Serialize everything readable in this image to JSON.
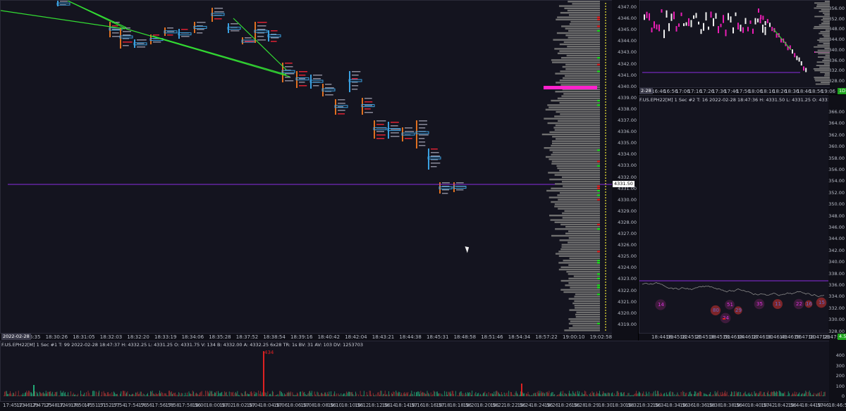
{
  "colors": {
    "background": "#14141f",
    "poc": "#ff22cc",
    "last_price_line": "#8a2be2",
    "volume_bars": "#6f6f6f",
    "trend_lines": "#33dd33"
  },
  "main_chart": {
    "price_axis": [
      "4347.00",
      "4346.00",
      "4345.00",
      "4344.00",
      "4343.00",
      "4342.00",
      "4341.00",
      "4340.00",
      "4339.00",
      "4338.00",
      "4337.00",
      "4336.00",
      "4335.00",
      "4334.00",
      "4333.00",
      "4332.00",
      "4331.00",
      "4330.00",
      "4329.00",
      "4328.00",
      "4327.00",
      "4326.00",
      "4325.00",
      "4324.00",
      "4323.00",
      "4322.00",
      "4321.00",
      "4320.00",
      "4319.00"
    ],
    "last_price_tag": "4331.50",
    "time_axis": [
      "18:26:35",
      "18:30:26",
      "18:31:05",
      "18:32:03",
      "18:32:20",
      "18:33:19",
      "18:34:06",
      "18:35:28",
      "18:37:52",
      "18:38:54",
      "18:39:16",
      "18:40:42",
      "18:42:04",
      "18:43:21",
      "18:44:38",
      "18:45:31",
      "18:48:58",
      "18:51:46",
      "18:54:34",
      "18:57:22",
      "19:00:10",
      "19:02:58"
    ],
    "date_tag": "2022-02-28"
  },
  "top_right_chart": {
    "price_axis": [
      "4356.00",
      "4352.00",
      "4348.00",
      "4344.00",
      "4340.00",
      "4336.00",
      "4332.00",
      "4328.00"
    ],
    "time_axis": [
      "16:46",
      "16:56",
      "17:06",
      "17:16",
      "17:26",
      "17:36",
      "17:46",
      "17:56",
      "18:06",
      "18:16",
      "18:26",
      "18:36",
      "18:46",
      "18:56",
      "19:06"
    ],
    "date_tag": "2-28",
    "corner_tag": "1D"
  },
  "mid_right_chart": {
    "info": "F.US.EPH22[M]  1 Sec  #2  T: 16  2022-02-28 18:47:36 H: 4331.50 L: 4331.25 O: 4331.25 V: 22 B: 433",
    "price_axis": [
      "4366.00",
      "4364.00",
      "4362.00",
      "4360.00",
      "4358.00",
      "4356.00",
      "4354.00",
      "4352.00",
      "4350.00",
      "4348.00",
      "4346.00",
      "4344.00",
      "4342.00",
      "4340.00",
      "4338.00",
      "4336.00",
      "4334.00",
      "4332.00",
      "4330.00",
      "4328.00"
    ],
    "time_axis": [
      "18:44:39",
      "18:45:12",
      "18:45:25",
      "18:45:38",
      "18:45:51",
      "18:46:04",
      "18:46:17",
      "18:46:30",
      "18:46:43",
      "18:46:56",
      "18:47:10",
      "18:47:23",
      "18:47:36"
    ],
    "bubble_labels": [
      "14",
      "80",
      "51",
      "29",
      "35",
      "11",
      "22",
      "16",
      "24",
      "15"
    ],
    "corner_tag": "4.5"
  },
  "bottom_chart": {
    "info": "F.US.EPH22[M]  1 Sec  #1  T: 99  2022-02-28 18:47:37 H: 4332.25 L: 4331.25 O: 4331.75 V: 134 B: 4332.00 A: 4332.25 6x28 TR: 1s BV: 31 AV: 103 DV: 1253703",
    "symbol_badge": "4331.25",
    "volume_axis": [
      "400",
      "300",
      "200",
      "100",
      "0"
    ],
    "time_axis": [
      "17:45:13",
      "17:46:29",
      "17:47:25",
      "17:48:32",
      "17:49:38",
      "17:50:45",
      "17:51:51",
      "17:52:57",
      "17:54",
      "17:54:56",
      "17:56",
      "17:56:58",
      "17:58",
      "17:58:56",
      "18:00",
      "18:00:57",
      "18:02",
      "18:02:57",
      "18:04",
      "18:04:57",
      "18:06",
      "18:06:57",
      "18:08",
      "18:08:56",
      "18:10",
      "18:10:56",
      "18:12",
      "18:12:56",
      "18:14",
      "18:14:57",
      "18:16",
      "18:16:57",
      "18:18",
      "18:18:56",
      "18:20",
      "18:20:56",
      "18:22",
      "18:22:56",
      "18:24",
      "18:24:56",
      "18:26",
      "18:26:56",
      "18:28",
      "18:29",
      "18:30",
      "18:30:58",
      "18:32",
      "18:32:56",
      "18:34",
      "18:34:56",
      "18:36",
      "18:36:58",
      "18:38",
      "18:38:56",
      "18:40",
      "18:40:57",
      "18:42",
      "18:42:56",
      "18:44",
      "18:44:57",
      "18:46",
      "18:46:56"
    ],
    "spike_label": "434"
  }
}
